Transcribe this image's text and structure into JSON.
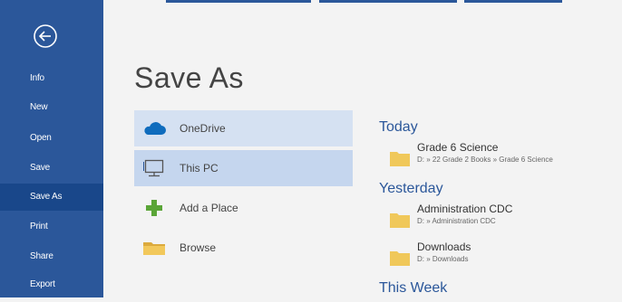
{
  "nav": {
    "items": [
      {
        "label": "Info",
        "active": false
      },
      {
        "label": "New",
        "active": false
      },
      {
        "label": "Open",
        "active": false
      },
      {
        "label": "Save",
        "active": false
      },
      {
        "label": "Save As",
        "active": true
      },
      {
        "label": "Print",
        "active": false
      },
      {
        "label": "Share",
        "active": false
      },
      {
        "label": "Export",
        "active": false
      }
    ],
    "back_icon": "back-arrow-icon"
  },
  "page": {
    "title": "Save As"
  },
  "places": [
    {
      "label": "OneDrive",
      "icon": "cloud-icon"
    },
    {
      "label": "This PC",
      "icon": "computer-icon"
    },
    {
      "label": "Add a Place",
      "icon": "plus-icon"
    },
    {
      "label": "Browse",
      "icon": "folder-icon"
    }
  ],
  "recent": {
    "today": {
      "title": "Today",
      "items": [
        {
          "name": "Grade 6 Science",
          "path": "D: » 22 Grade 2 Books » Grade 6 Science"
        }
      ]
    },
    "yesterday": {
      "title": "Yesterday",
      "items": [
        {
          "name": "Administration CDC",
          "path": "D: » Administration CDC"
        },
        {
          "name": "Downloads",
          "path": "D: » Downloads"
        }
      ]
    },
    "this_week": {
      "title": "This Week"
    }
  },
  "colors": {
    "accent": "#2b579a",
    "nav_active": "#19478a",
    "selected_place": "#c5d6ee",
    "folder": "#f0c85a"
  }
}
